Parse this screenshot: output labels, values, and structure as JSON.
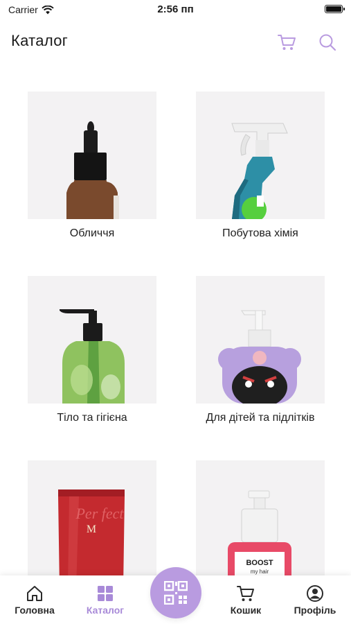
{
  "status_bar": {
    "carrier": "Carrier",
    "time": "2:56 пп"
  },
  "header": {
    "title": "Каталог",
    "cart_icon": "cart-icon",
    "search_icon": "search-icon"
  },
  "categories": [
    {
      "label": "Обличчя"
    },
    {
      "label": "Побутова хімія"
    },
    {
      "label": "Тіло та гігієна"
    },
    {
      "label": "Для дітей та підлітків"
    },
    {
      "label": ""
    },
    {
      "label": ""
    }
  ],
  "product_text": {
    "tube_brand": "M",
    "tube_name": "Per fect",
    "bottle_name": "BOOST",
    "bottle_sub": "my hair"
  },
  "tabbar": {
    "tabs": [
      {
        "label": "Головна",
        "icon": "home-icon"
      },
      {
        "label": "Каталог",
        "icon": "grid-icon"
      },
      {
        "label": "Кошик",
        "icon": "cart-icon"
      },
      {
        "label": "Профіль",
        "icon": "profile-icon"
      }
    ],
    "center_icon": "qr-icon"
  },
  "colors": {
    "accent": "#b99be0",
    "accent_text": "#a88ad8",
    "thumb_bg": "#f3f2f3"
  }
}
